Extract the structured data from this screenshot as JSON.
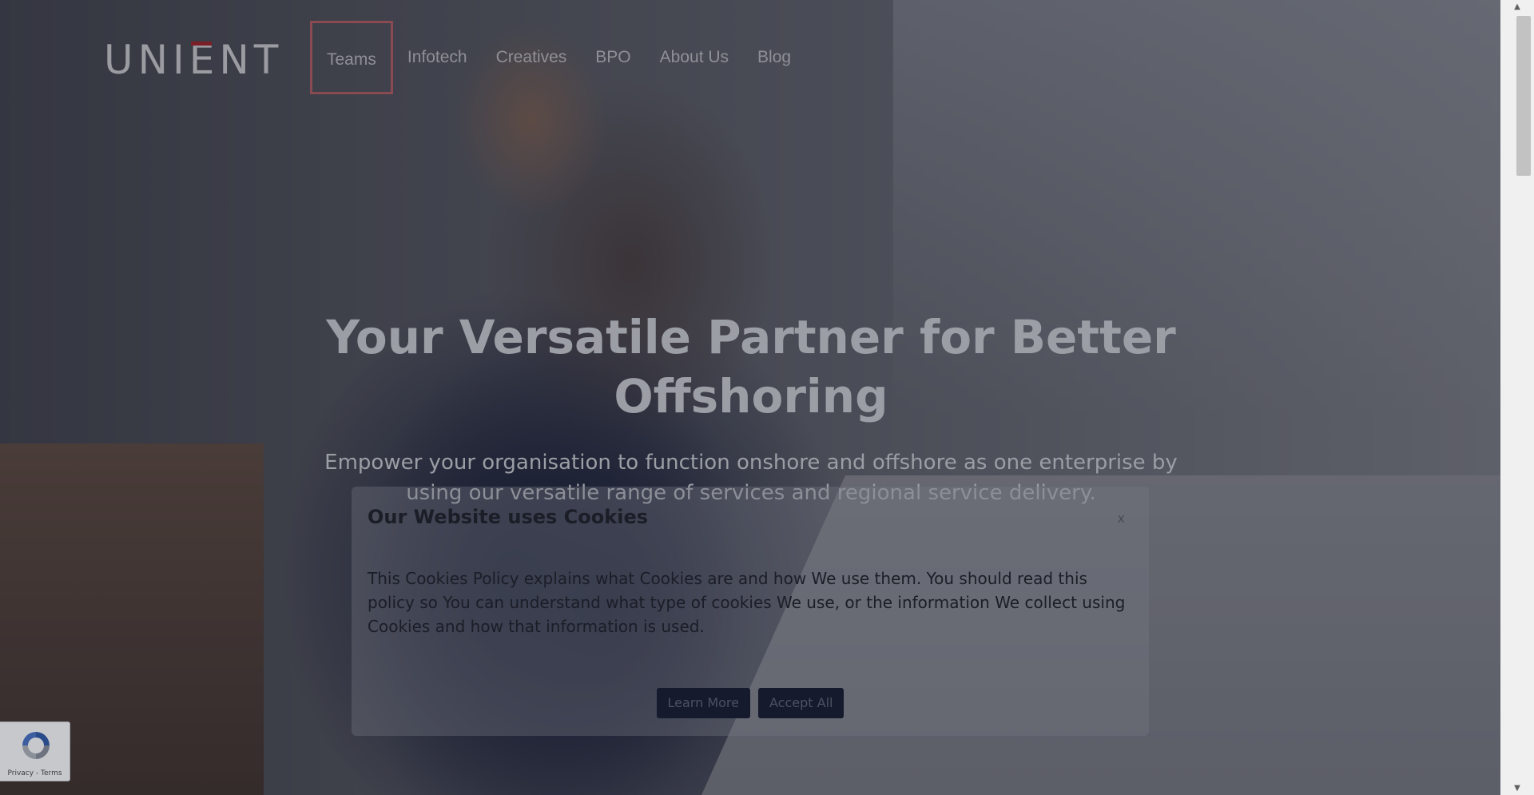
{
  "brand": {
    "logo_text": "UNIENT"
  },
  "nav": {
    "items": [
      {
        "label": "Teams",
        "active": true
      },
      {
        "label": "Infotech"
      },
      {
        "label": "Creatives"
      },
      {
        "label": "BPO"
      },
      {
        "label": "About Us"
      },
      {
        "label": "Blog"
      }
    ]
  },
  "hero": {
    "title": "Your Versatile Partner for Better Offshoring",
    "subtitle": "Empower your organisation to function onshore and offshore as one enterprise by using our versatile range of services and regional service delivery."
  },
  "cookie": {
    "title": "Our Website uses Cookies",
    "close_label": "x",
    "body": "This Cookies Policy explains what Cookies are and how We use them. You should read this policy so You can understand what type of cookies We use, or the information We collect using Cookies and how that information is used.",
    "learn_more_label": "Learn More",
    "accept_all_label": "Accept All"
  },
  "recaptcha": {
    "links": "Privacy - Terms"
  },
  "colors": {
    "accent": "#8a4a52",
    "button_bg": "#151a2d"
  },
  "icons": {
    "recaptcha": "recaptcha-icon",
    "scroll_up": "scroll-up-arrow-icon",
    "scroll_down": "scroll-down-arrow-icon"
  }
}
